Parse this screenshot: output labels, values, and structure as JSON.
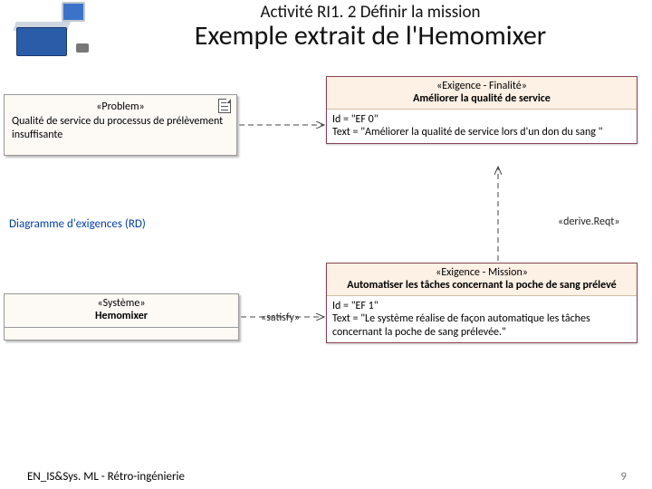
{
  "header": {
    "title": "Activité RI1. 2 Définir la mission",
    "subtitle": "Exemple extrait de l'Hemomixer"
  },
  "problem": {
    "stereotype": "«Problem»",
    "text": "Qualité de service du processus de prélèvement insuffisante"
  },
  "req_finalite": {
    "stereotype": "«Exigence - Finalité»",
    "title": "Améliorer la qualité de service",
    "id_line": "Id = \"EF 0\"",
    "text_line": "Text = \"Améliorer la qualité de service lors d'un don du sang \""
  },
  "req_mission": {
    "stereotype": "«Exigence - Mission»",
    "title": "Automatiser les tâches concernant la poche de sang prélevé",
    "id_line": "Id = \"EF 1\"",
    "text_line": "Text = \"Le système réalise de façon automatique les tâches concernant la poche de sang prélevée.\""
  },
  "system": {
    "stereotype": "«Système»",
    "name": "Hemomixer"
  },
  "relations": {
    "satisfy": "«satisfy»",
    "derive": "«derive.Reqt»"
  },
  "caption": "Diagramme d'exigences (RD)",
  "footer": {
    "left": "EN_IS&Sys. ML - Rétro-ingénierie",
    "page": "9"
  }
}
